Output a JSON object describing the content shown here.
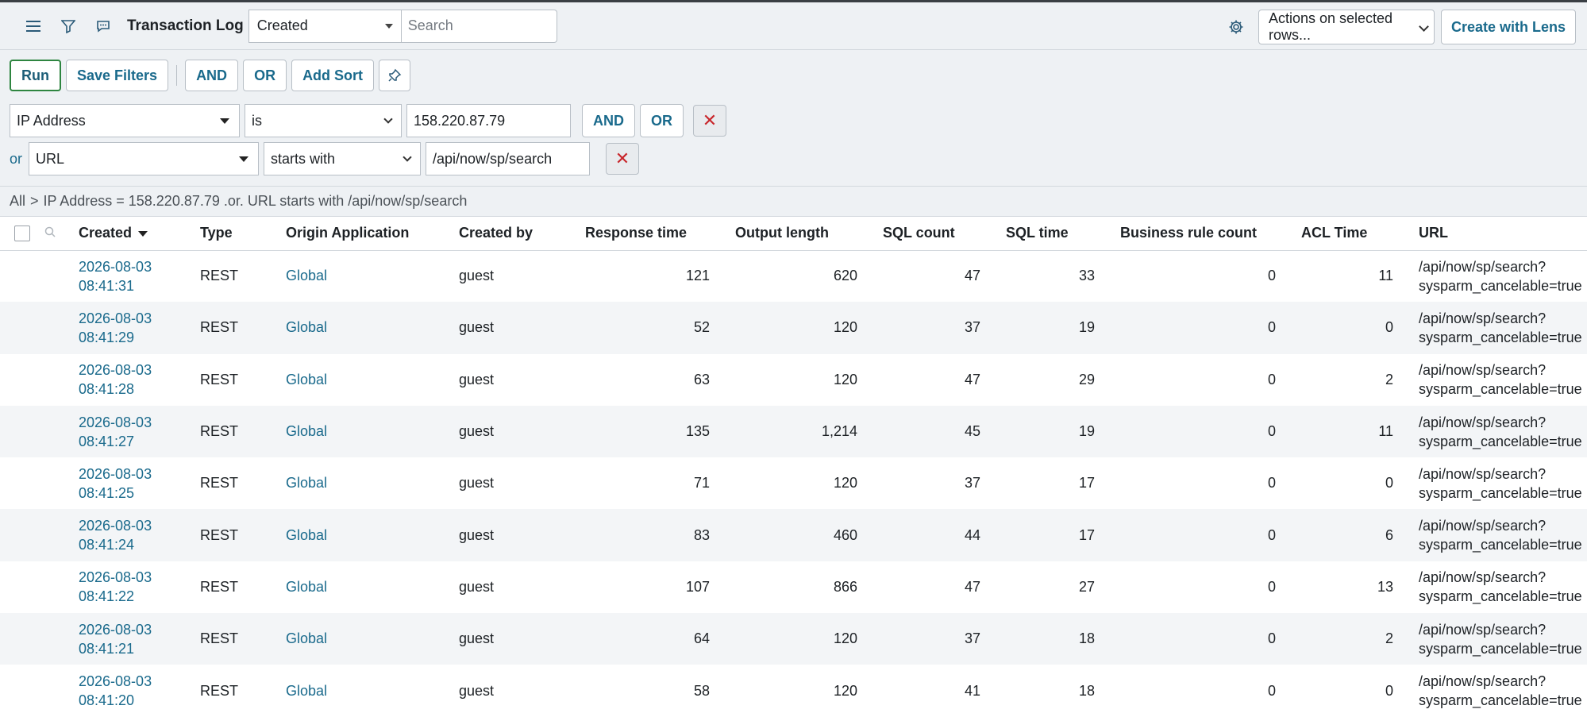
{
  "header": {
    "title": "Transaction Log",
    "view_select": "Created",
    "search_placeholder": "Search",
    "actions_select": "Actions on selected rows...",
    "create_lens": "Create with Lens"
  },
  "filter_buttons": {
    "run": "Run",
    "save_filters": "Save Filters",
    "and": "AND",
    "or": "OR",
    "add_sort": "Add Sort"
  },
  "conditions": [
    {
      "prefix": "",
      "field": "IP Address",
      "operator": "is",
      "value": "158.220.87.79",
      "and": "AND",
      "or": "OR"
    },
    {
      "prefix": "or",
      "field": "URL",
      "operator": "starts with",
      "value": "/api/now/sp/search"
    }
  ],
  "breadcrumb": {
    "root": "All",
    "separator": ">",
    "query": "IP Address = 158.220.87.79 .or. URL starts with /api/now/sp/search"
  },
  "table": {
    "columns": [
      "Created",
      "Type",
      "Origin Application",
      "Created by",
      "Response time",
      "Output length",
      "SQL count",
      "SQL time",
      "Business rule count",
      "ACL Time",
      "URL"
    ],
    "rows": [
      {
        "date": "2026-08-03",
        "time": "08:41:31",
        "type": "REST",
        "origin": "Global",
        "created_by": "guest",
        "response": "121",
        "output": "620",
        "sql_count": "47",
        "sql_time": "33",
        "br_count": "0",
        "acl": "11",
        "url1": "/api/now/sp/search?",
        "url2": "sysparm_cancelable=true"
      },
      {
        "date": "2026-08-03",
        "time": "08:41:29",
        "type": "REST",
        "origin": "Global",
        "created_by": "guest",
        "response": "52",
        "output": "120",
        "sql_count": "37",
        "sql_time": "19",
        "br_count": "0",
        "acl": "0",
        "url1": "/api/now/sp/search?",
        "url2": "sysparm_cancelable=true"
      },
      {
        "date": "2026-08-03",
        "time": "08:41:28",
        "type": "REST",
        "origin": "Global",
        "created_by": "guest",
        "response": "63",
        "output": "120",
        "sql_count": "47",
        "sql_time": "29",
        "br_count": "0",
        "acl": "2",
        "url1": "/api/now/sp/search?",
        "url2": "sysparm_cancelable=true"
      },
      {
        "date": "2026-08-03",
        "time": "08:41:27",
        "type": "REST",
        "origin": "Global",
        "created_by": "guest",
        "response": "135",
        "output": "1,214",
        "sql_count": "45",
        "sql_time": "19",
        "br_count": "0",
        "acl": "11",
        "url1": "/api/now/sp/search?",
        "url2": "sysparm_cancelable=true"
      },
      {
        "date": "2026-08-03",
        "time": "08:41:25",
        "type": "REST",
        "origin": "Global",
        "created_by": "guest",
        "response": "71",
        "output": "120",
        "sql_count": "37",
        "sql_time": "17",
        "br_count": "0",
        "acl": "0",
        "url1": "/api/now/sp/search?",
        "url2": "sysparm_cancelable=true"
      },
      {
        "date": "2026-08-03",
        "time": "08:41:24",
        "type": "REST",
        "origin": "Global",
        "created_by": "guest",
        "response": "83",
        "output": "460",
        "sql_count": "44",
        "sql_time": "17",
        "br_count": "0",
        "acl": "6",
        "url1": "/api/now/sp/search?",
        "url2": "sysparm_cancelable=true"
      },
      {
        "date": "2026-08-03",
        "time": "08:41:22",
        "type": "REST",
        "origin": "Global",
        "created_by": "guest",
        "response": "107",
        "output": "866",
        "sql_count": "47",
        "sql_time": "27",
        "br_count": "0",
        "acl": "13",
        "url1": "/api/now/sp/search?",
        "url2": "sysparm_cancelable=true"
      },
      {
        "date": "2026-08-03",
        "time": "08:41:21",
        "type": "REST",
        "origin": "Global",
        "created_by": "guest",
        "response": "64",
        "output": "120",
        "sql_count": "37",
        "sql_time": "18",
        "br_count": "0",
        "acl": "2",
        "url1": "/api/now/sp/search?",
        "url2": "sysparm_cancelable=true"
      },
      {
        "date": "2026-08-03",
        "time": "08:41:20",
        "type": "REST",
        "origin": "Global",
        "created_by": "guest",
        "response": "58",
        "output": "120",
        "sql_count": "41",
        "sql_time": "18",
        "br_count": "0",
        "acl": "0",
        "url1": "/api/now/sp/search?",
        "url2": "sysparm_cancelable=true"
      }
    ]
  },
  "icons": {
    "menu": "hamburger-icon",
    "filter": "funnel-icon",
    "comment": "comment-icon",
    "settings": "gear-icon",
    "pin": "pin-icon",
    "delete": "close-icon"
  },
  "colors": {
    "link": "#1a6a8c",
    "run_border": "#2e8540",
    "delete": "#c8262b",
    "band": "#eef1f4"
  }
}
